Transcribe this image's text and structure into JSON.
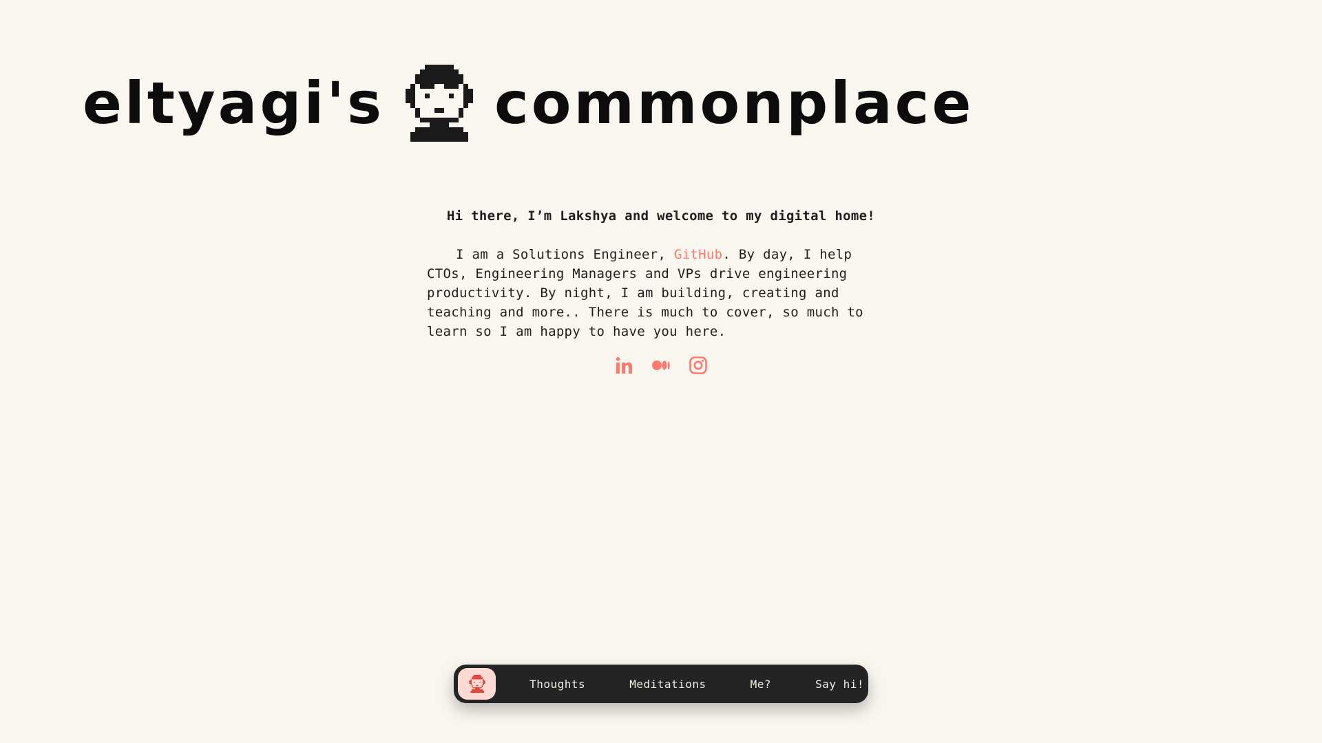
{
  "header": {
    "title_left": "eltyagi's",
    "title_right": "commonplace",
    "avatar_icon": "pixel-avatar-icon"
  },
  "intro": {
    "greeting": "Hi there, I’m Lakshya and welcome to my digital home!",
    "bio_before": "I am a Solutions Engineer, ",
    "bio_link": "GitHub",
    "bio_after": ". By day, I help CTOs, Engineering Managers and VPs drive engineering productivity. By night, I am building, creating and teaching and more.. There is much to cover, so much to learn so I am happy to have you here."
  },
  "socials": [
    {
      "name": "LinkedIn",
      "icon": "linkedin-icon"
    },
    {
      "name": "Medium",
      "icon": "medium-icon"
    },
    {
      "name": "Instagram",
      "icon": "instagram-icon"
    }
  ],
  "nav": {
    "home_icon": "avatar-home-icon",
    "items": [
      "Thoughts",
      "Meditations",
      "Me?",
      "Say hi!"
    ]
  },
  "colors": {
    "background": "#f8f6ef",
    "accent": "#ff7a6e",
    "nav_bg": "#242424",
    "nav_home_bg": "#ffd9d3",
    "text": "#1f1f1f"
  }
}
